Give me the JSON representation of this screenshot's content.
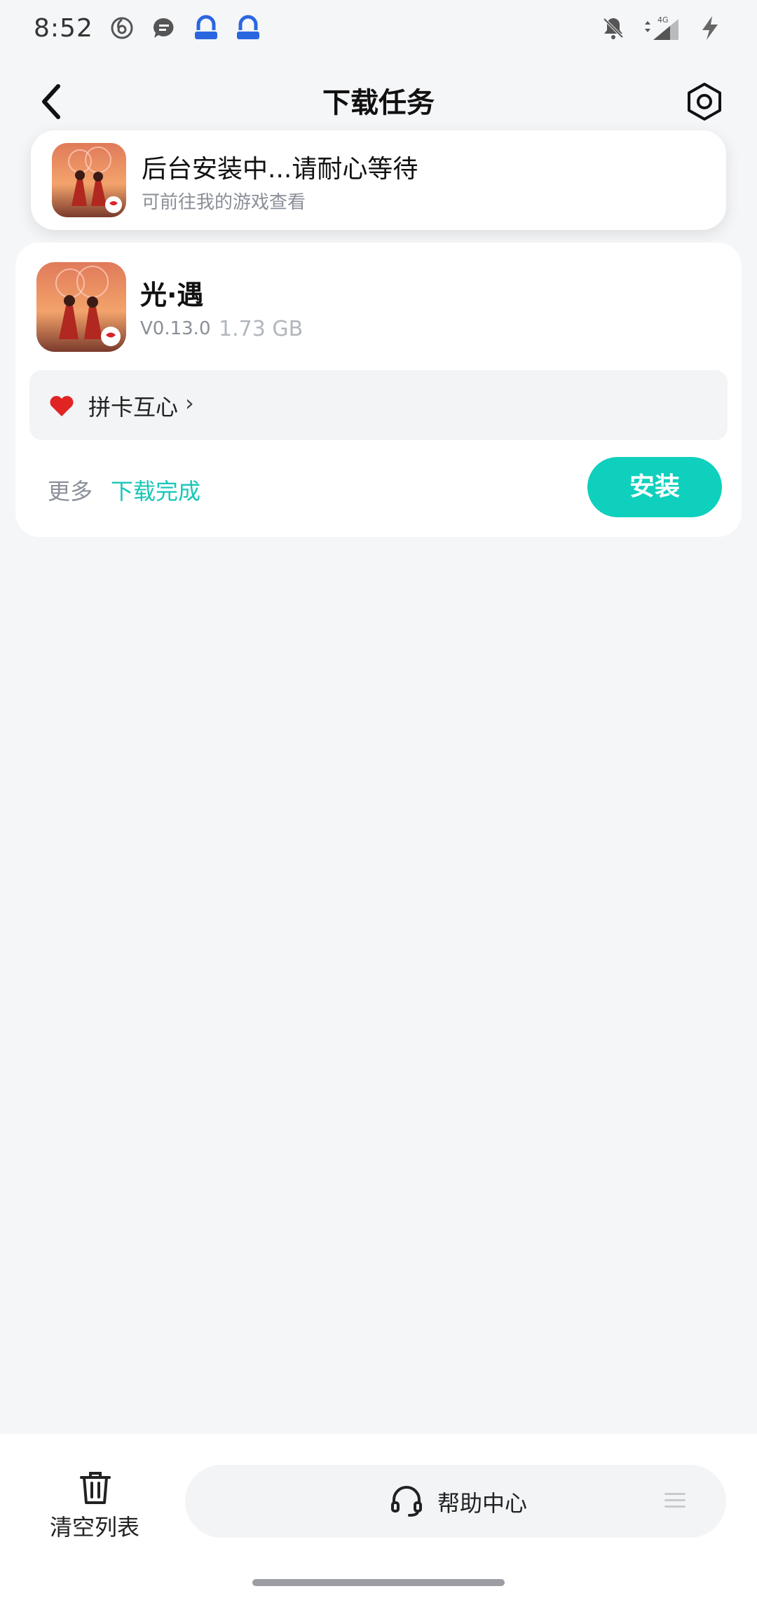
{
  "status_bar": {
    "time": "8:52",
    "left_icons": [
      "netease-music-icon",
      "message-bubble-icon",
      "security-app-icon",
      "security-app-icon"
    ],
    "right_icons": [
      "bell-muted-icon",
      "data-arrows-icon",
      "signal-4g-icon",
      "charging-bolt-icon"
    ],
    "network": "4G"
  },
  "header": {
    "title": "下载任务"
  },
  "toast": {
    "title": "后台安装中...请耐心等待",
    "subtitle": "可前往我的游戏查看"
  },
  "task": {
    "app_name": "光·遇",
    "version": "V0.13.0",
    "size": "1.73 GB",
    "promo_text": "拼卡互心",
    "promo_chevron": "›",
    "more_label": "更多",
    "status_label": "下载完成",
    "install_label": "安装"
  },
  "bottom": {
    "clear_label": "清空列表",
    "help_label": "帮助中心"
  },
  "colors": {
    "accent": "#0ed0bd",
    "accent_text": "#18c7b8",
    "background": "#f5f6f8",
    "card": "#ffffff",
    "muted_text": "#8a8f98"
  }
}
